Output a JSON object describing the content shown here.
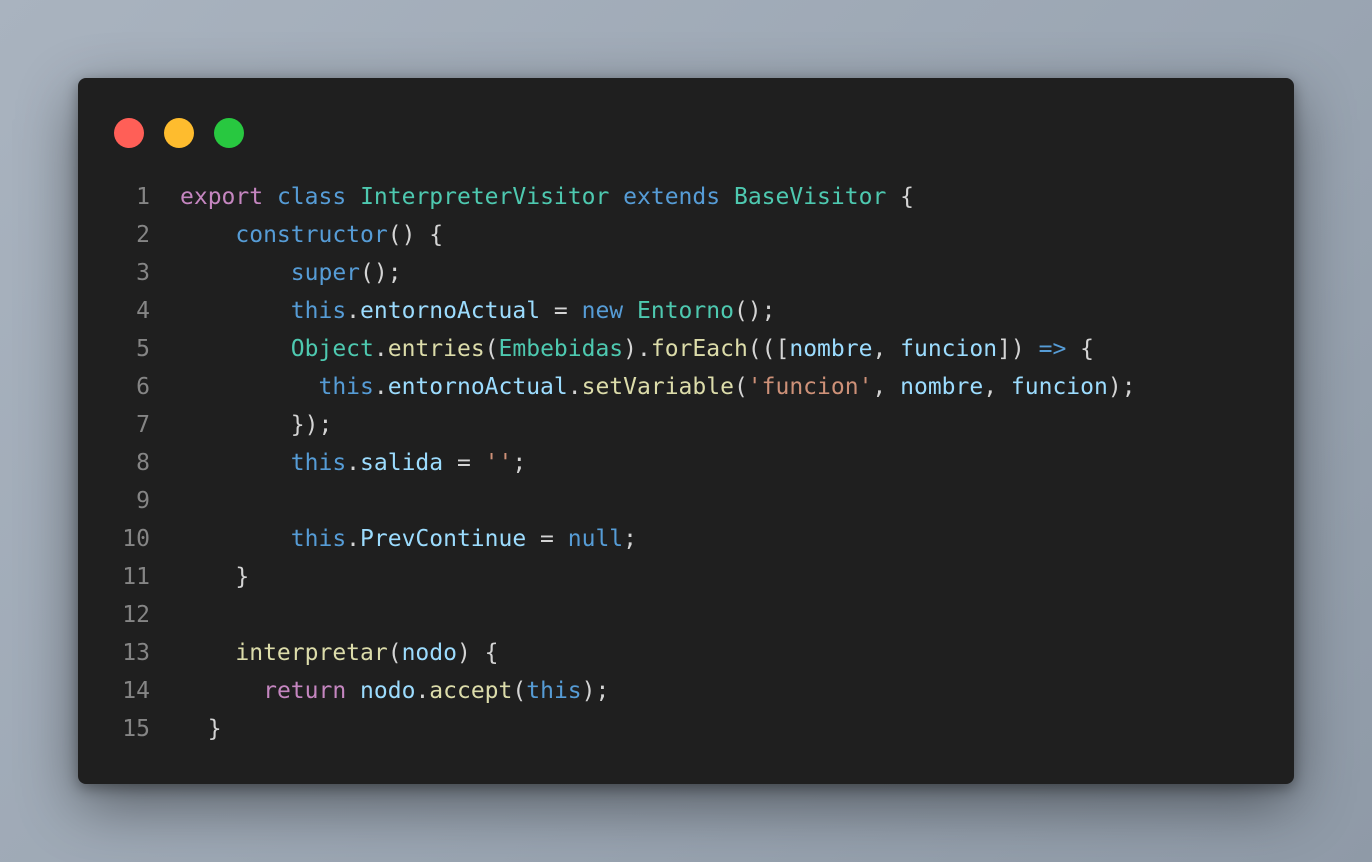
{
  "window": {
    "controls": [
      {
        "name": "close",
        "color": "#ff5f57"
      },
      {
        "name": "minimize",
        "color": "#febc2e"
      },
      {
        "name": "maximize",
        "color": "#28c840"
      }
    ]
  },
  "code": {
    "language": "javascript",
    "lines": [
      {
        "number": "1",
        "tokens": [
          {
            "t": "export",
            "c": "kw-p"
          },
          {
            "t": " ",
            "c": "pun"
          },
          {
            "t": "class",
            "c": "kw-b"
          },
          {
            "t": " ",
            "c": "pun"
          },
          {
            "t": "InterpreterVisitor",
            "c": "cls"
          },
          {
            "t": " ",
            "c": "pun"
          },
          {
            "t": "extends",
            "c": "kw-b"
          },
          {
            "t": " ",
            "c": "pun"
          },
          {
            "t": "BaseVisitor",
            "c": "cls"
          },
          {
            "t": " {",
            "c": "pun"
          }
        ]
      },
      {
        "number": "2",
        "tokens": [
          {
            "t": "    ",
            "c": "pun"
          },
          {
            "t": "constructor",
            "c": "kw-b"
          },
          {
            "t": "() {",
            "c": "pun"
          }
        ]
      },
      {
        "number": "3",
        "tokens": [
          {
            "t": "        ",
            "c": "pun"
          },
          {
            "t": "super",
            "c": "kw-b"
          },
          {
            "t": "();",
            "c": "pun"
          }
        ]
      },
      {
        "number": "4",
        "tokens": [
          {
            "t": "        ",
            "c": "pun"
          },
          {
            "t": "this",
            "c": "kw-b"
          },
          {
            "t": ".",
            "c": "pun"
          },
          {
            "t": "entornoActual",
            "c": "var"
          },
          {
            "t": " = ",
            "c": "pun"
          },
          {
            "t": "new",
            "c": "kw-b"
          },
          {
            "t": " ",
            "c": "pun"
          },
          {
            "t": "Entorno",
            "c": "cls"
          },
          {
            "t": "();",
            "c": "pun"
          }
        ]
      },
      {
        "number": "5",
        "tokens": [
          {
            "t": "        ",
            "c": "pun"
          },
          {
            "t": "Object",
            "c": "cls"
          },
          {
            "t": ".",
            "c": "pun"
          },
          {
            "t": "entries",
            "c": "fn"
          },
          {
            "t": "(",
            "c": "pun"
          },
          {
            "t": "Embebidas",
            "c": "cls"
          },
          {
            "t": ").",
            "c": "pun"
          },
          {
            "t": "forEach",
            "c": "fn"
          },
          {
            "t": "(([",
            "c": "pun"
          },
          {
            "t": "nombre",
            "c": "var"
          },
          {
            "t": ", ",
            "c": "pun"
          },
          {
            "t": "funcion",
            "c": "var"
          },
          {
            "t": "]) ",
            "c": "pun"
          },
          {
            "t": "=>",
            "c": "kw-b"
          },
          {
            "t": " {",
            "c": "pun"
          }
        ]
      },
      {
        "number": "6",
        "tokens": [
          {
            "t": "          ",
            "c": "pun"
          },
          {
            "t": "this",
            "c": "kw-b"
          },
          {
            "t": ".",
            "c": "pun"
          },
          {
            "t": "entornoActual",
            "c": "var"
          },
          {
            "t": ".",
            "c": "pun"
          },
          {
            "t": "setVariable",
            "c": "fn"
          },
          {
            "t": "(",
            "c": "pun"
          },
          {
            "t": "'funcion'",
            "c": "str"
          },
          {
            "t": ", ",
            "c": "pun"
          },
          {
            "t": "nombre",
            "c": "var"
          },
          {
            "t": ", ",
            "c": "pun"
          },
          {
            "t": "funcion",
            "c": "var"
          },
          {
            "t": ");",
            "c": "pun"
          }
        ]
      },
      {
        "number": "7",
        "tokens": [
          {
            "t": "        });",
            "c": "pun"
          }
        ]
      },
      {
        "number": "8",
        "tokens": [
          {
            "t": "        ",
            "c": "pun"
          },
          {
            "t": "this",
            "c": "kw-b"
          },
          {
            "t": ".",
            "c": "pun"
          },
          {
            "t": "salida",
            "c": "var"
          },
          {
            "t": " = ",
            "c": "pun"
          },
          {
            "t": "''",
            "c": "str"
          },
          {
            "t": ";",
            "c": "pun"
          }
        ]
      },
      {
        "number": "9",
        "tokens": []
      },
      {
        "number": "10",
        "tokens": [
          {
            "t": "        ",
            "c": "pun"
          },
          {
            "t": "this",
            "c": "kw-b"
          },
          {
            "t": ".",
            "c": "pun"
          },
          {
            "t": "PrevContinue",
            "c": "var"
          },
          {
            "t": " = ",
            "c": "pun"
          },
          {
            "t": "null",
            "c": "kw-b"
          },
          {
            "t": ";",
            "c": "pun"
          }
        ]
      },
      {
        "number": "11",
        "tokens": [
          {
            "t": "    }",
            "c": "pun"
          }
        ]
      },
      {
        "number": "12",
        "tokens": []
      },
      {
        "number": "13",
        "tokens": [
          {
            "t": "    ",
            "c": "pun"
          },
          {
            "t": "interpretar",
            "c": "fn"
          },
          {
            "t": "(",
            "c": "pun"
          },
          {
            "t": "nodo",
            "c": "var"
          },
          {
            "t": ") {",
            "c": "pun"
          }
        ]
      },
      {
        "number": "14",
        "tokens": [
          {
            "t": "      ",
            "c": "pun"
          },
          {
            "t": "return",
            "c": "kw-p"
          },
          {
            "t": " ",
            "c": "pun"
          },
          {
            "t": "nodo",
            "c": "var"
          },
          {
            "t": ".",
            "c": "pun"
          },
          {
            "t": "accept",
            "c": "fn"
          },
          {
            "t": "(",
            "c": "pun"
          },
          {
            "t": "this",
            "c": "kw-b"
          },
          {
            "t": ");",
            "c": "pun"
          }
        ]
      },
      {
        "number": "15",
        "tokens": [
          {
            "t": "  }",
            "c": "pun"
          }
        ]
      }
    ]
  }
}
